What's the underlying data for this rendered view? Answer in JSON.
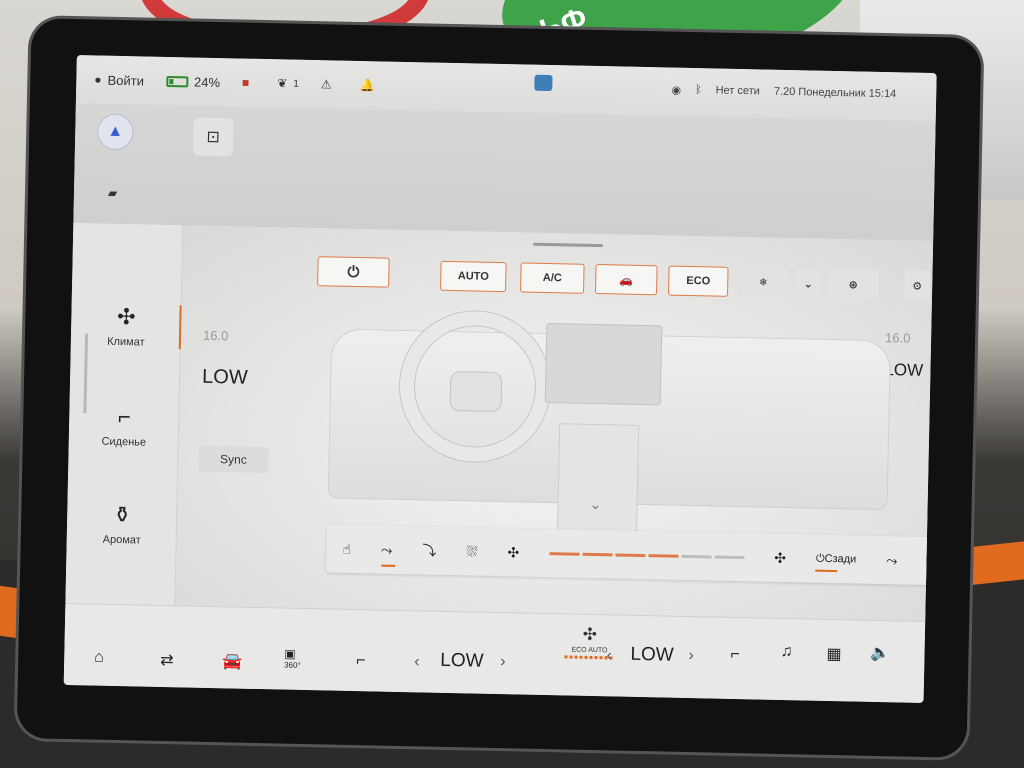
{
  "environment": {
    "logo_text": "ЬФ"
  },
  "statusbar": {
    "login_label": "Войти",
    "battery_percent": "24%",
    "notif_count": "1",
    "network": "Нет сети",
    "datetime": "7.20 Понедельник 15:14"
  },
  "rail": {
    "items": [
      {
        "label": "Климат",
        "icon": "fan-icon",
        "active": true
      },
      {
        "label": "Сиденье",
        "icon": "seat-icon",
        "active": false
      },
      {
        "label": "Аромат",
        "icon": "fragrance-icon",
        "active": false
      }
    ]
  },
  "climate": {
    "buttons": {
      "auto": "AUTO",
      "ac": "A/C",
      "eco": "ECO"
    },
    "driver_temp": "16.0",
    "driver_fan": "LOW",
    "passenger_temp": "16.0",
    "passenger_fan": "LOW",
    "sync_label": "Sync",
    "rear_label": "Сзади",
    "fan_level": 0.67,
    "accent_color": "#e06b1e"
  },
  "dock": {
    "left_fan": "LOW",
    "right_fan": "LOW",
    "eco_auto_label": "ECO AUTO",
    "camera_label": "360°"
  }
}
